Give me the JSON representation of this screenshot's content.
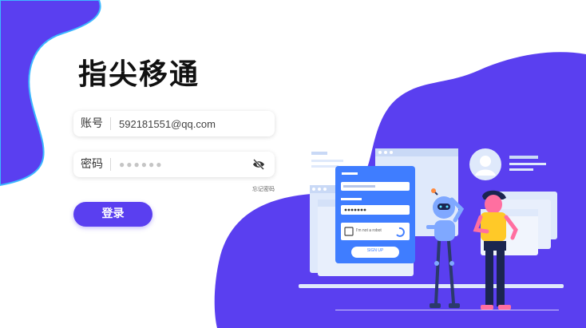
{
  "app": {
    "title": "指尖移通"
  },
  "login_form": {
    "account_label": "账号",
    "account_value": "592181551@qq.com",
    "password_label": "密码",
    "password_value": "●●●●●●",
    "forgot_password": "忘记密码",
    "login_button": "登录"
  },
  "illustration": {
    "checkbox_text": "I'm not a robot",
    "signup_button": "SIGN UP"
  },
  "colors": {
    "accent": "#5a3ff0",
    "blob_outline": "#3db8ff",
    "panel_light": "#dfe9fb",
    "form_card": "#3f7dff"
  },
  "icons": [
    "eye-hidden-icon",
    "user-avatar-icon",
    "recaptcha-icon"
  ]
}
